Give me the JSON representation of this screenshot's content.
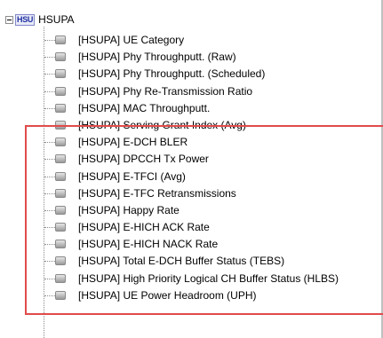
{
  "tree": {
    "root": {
      "icon": "hsupa-node-icon",
      "icon_text": "HSU",
      "label": "HSUPA"
    },
    "items": [
      {
        "label": "[HSUPA] UE Category"
      },
      {
        "label": "[HSUPA] Phy Throughputt. (Raw)"
      },
      {
        "label": "[HSUPA] Phy Throughputt. (Scheduled)"
      },
      {
        "label": "[HSUPA] Phy Re-Transmission Ratio"
      },
      {
        "label": "[HSUPA] MAC Throughputt."
      },
      {
        "label": "[HSUPA] Serving Grant Index (Avg)"
      },
      {
        "label": "[HSUPA] E-DCH BLER"
      },
      {
        "label": "[HSUPA] DPCCH Tx Power"
      },
      {
        "label": "[HSUPA] E-TFCI (Avg)"
      },
      {
        "label": "[HSUPA] E-TFC Retransmissions"
      },
      {
        "label": "[HSUPA] Happy Rate"
      },
      {
        "label": "[HSUPA] E-HICH ACK Rate"
      },
      {
        "label": "[HSUPA] E-HICH NACK Rate"
      },
      {
        "label": "[HSUPA] Total E-DCH Buffer Status (TEBS)"
      },
      {
        "label": "[HSUPA] High Priority Logical CH Buffer Status (HLBS)"
      },
      {
        "label": "[HSUPA] UE Power Headroom (UPH)"
      }
    ],
    "item_icon": "leaf-node-icon"
  },
  "highlight": {
    "color": "#e04b4b"
  }
}
